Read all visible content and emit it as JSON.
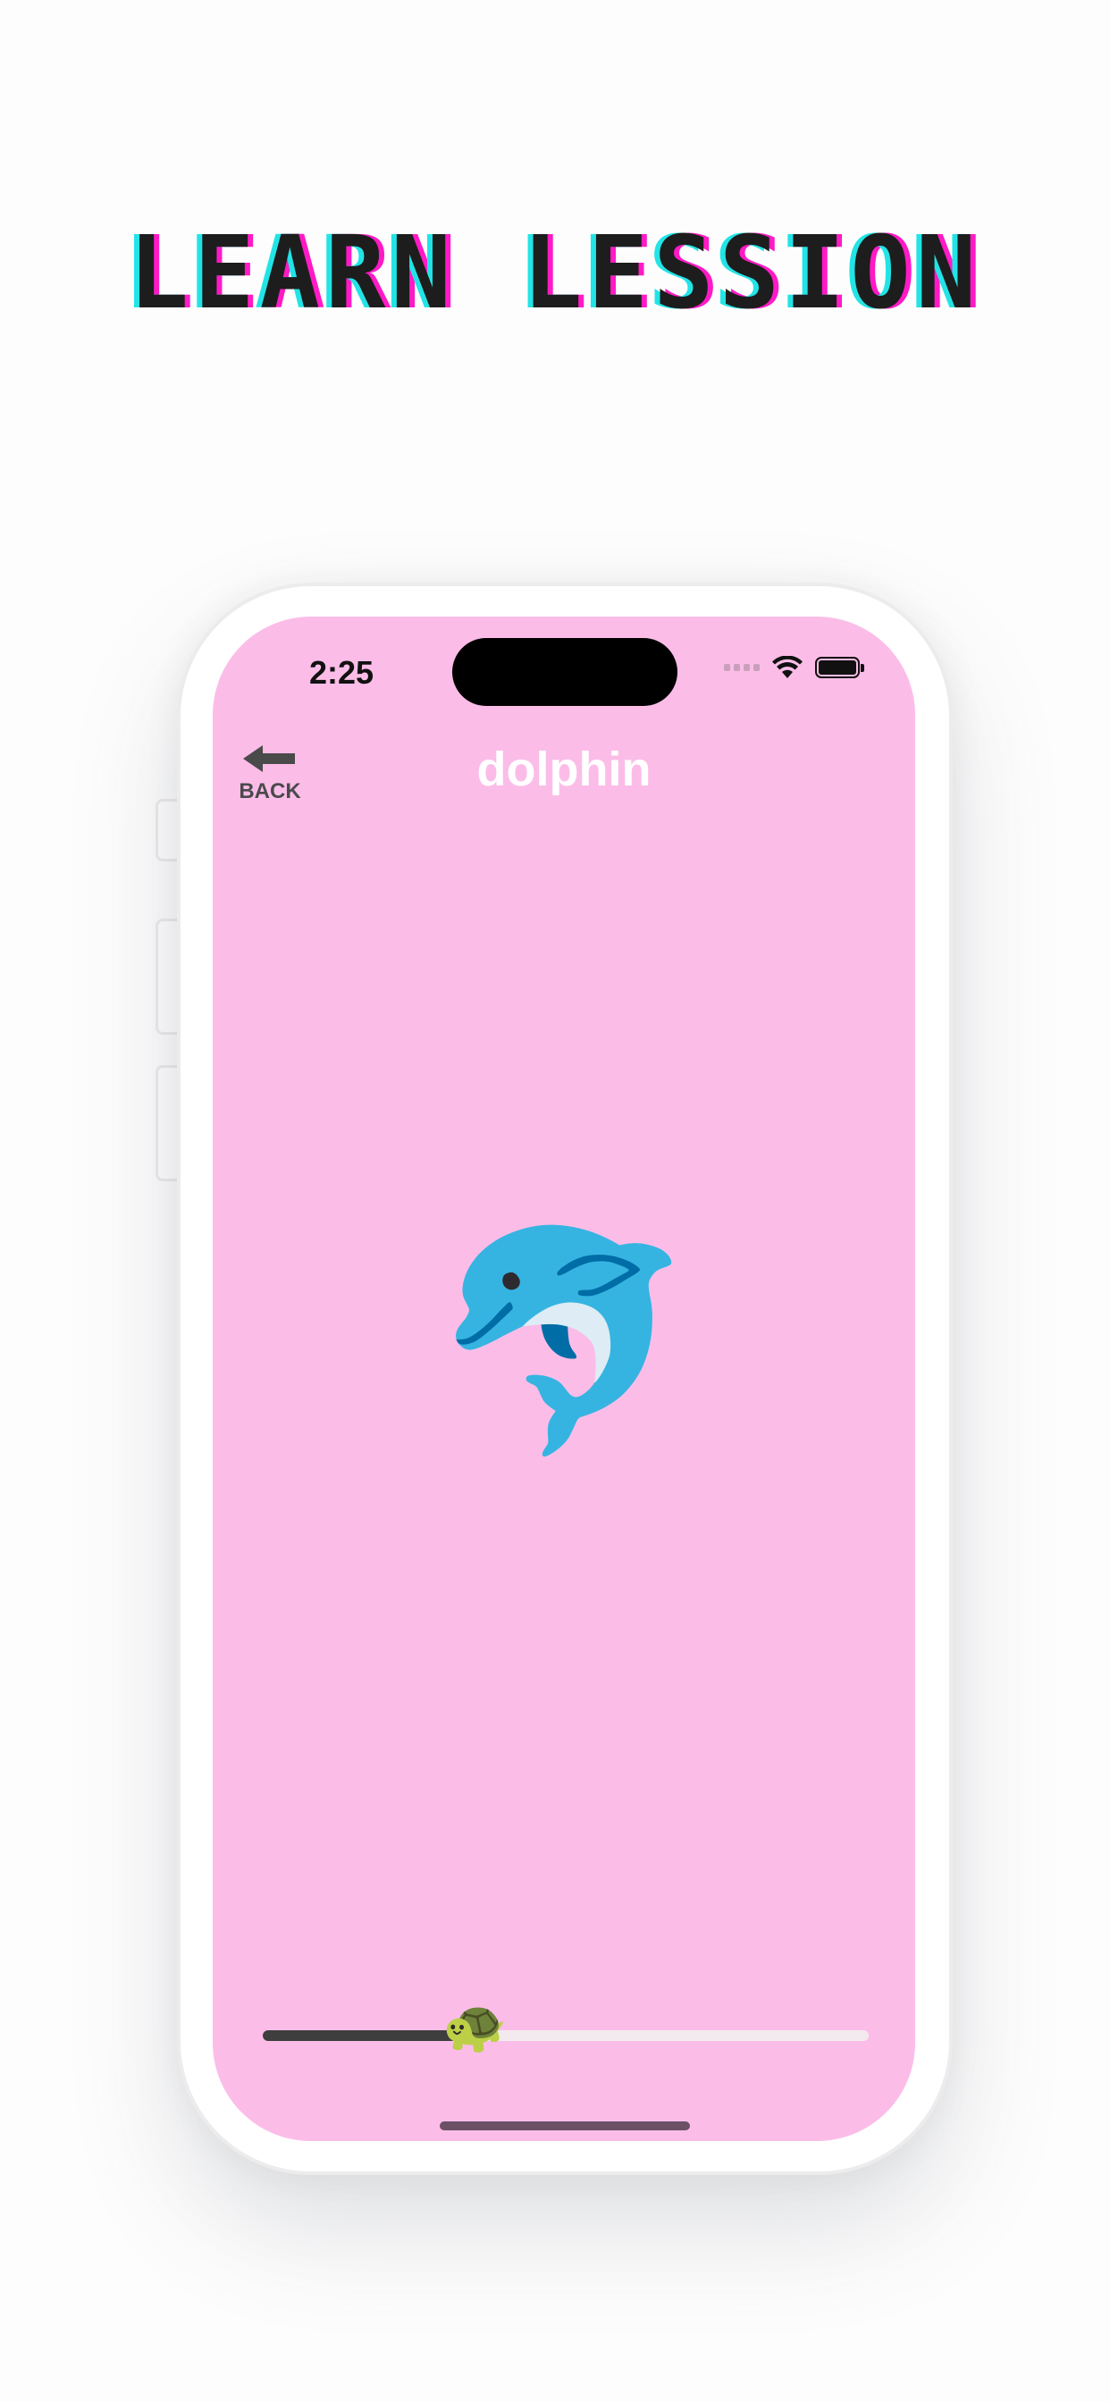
{
  "headline": "LEARN LESSION",
  "status_bar": {
    "time": "2:25",
    "wifi_icon": "wifi-icon",
    "battery_icon": "battery-icon"
  },
  "nav": {
    "back_label": "BACK",
    "back_icon": "arrow-left-icon",
    "title": "dolphin"
  },
  "lesson": {
    "emoji": "🐬",
    "emoji_name": "dolphin-emoji"
  },
  "progress": {
    "value": 0.35,
    "thumb_emoji": "🐢",
    "thumb_name": "turtle-icon"
  },
  "colors": {
    "screen_background": "#fbbde8",
    "progress_fill": "#3e3e3e",
    "progress_track": "#f3eaf0",
    "headline_glitch_cyan": "#22e4e6",
    "headline_glitch_magenta": "#ff1ac6"
  }
}
